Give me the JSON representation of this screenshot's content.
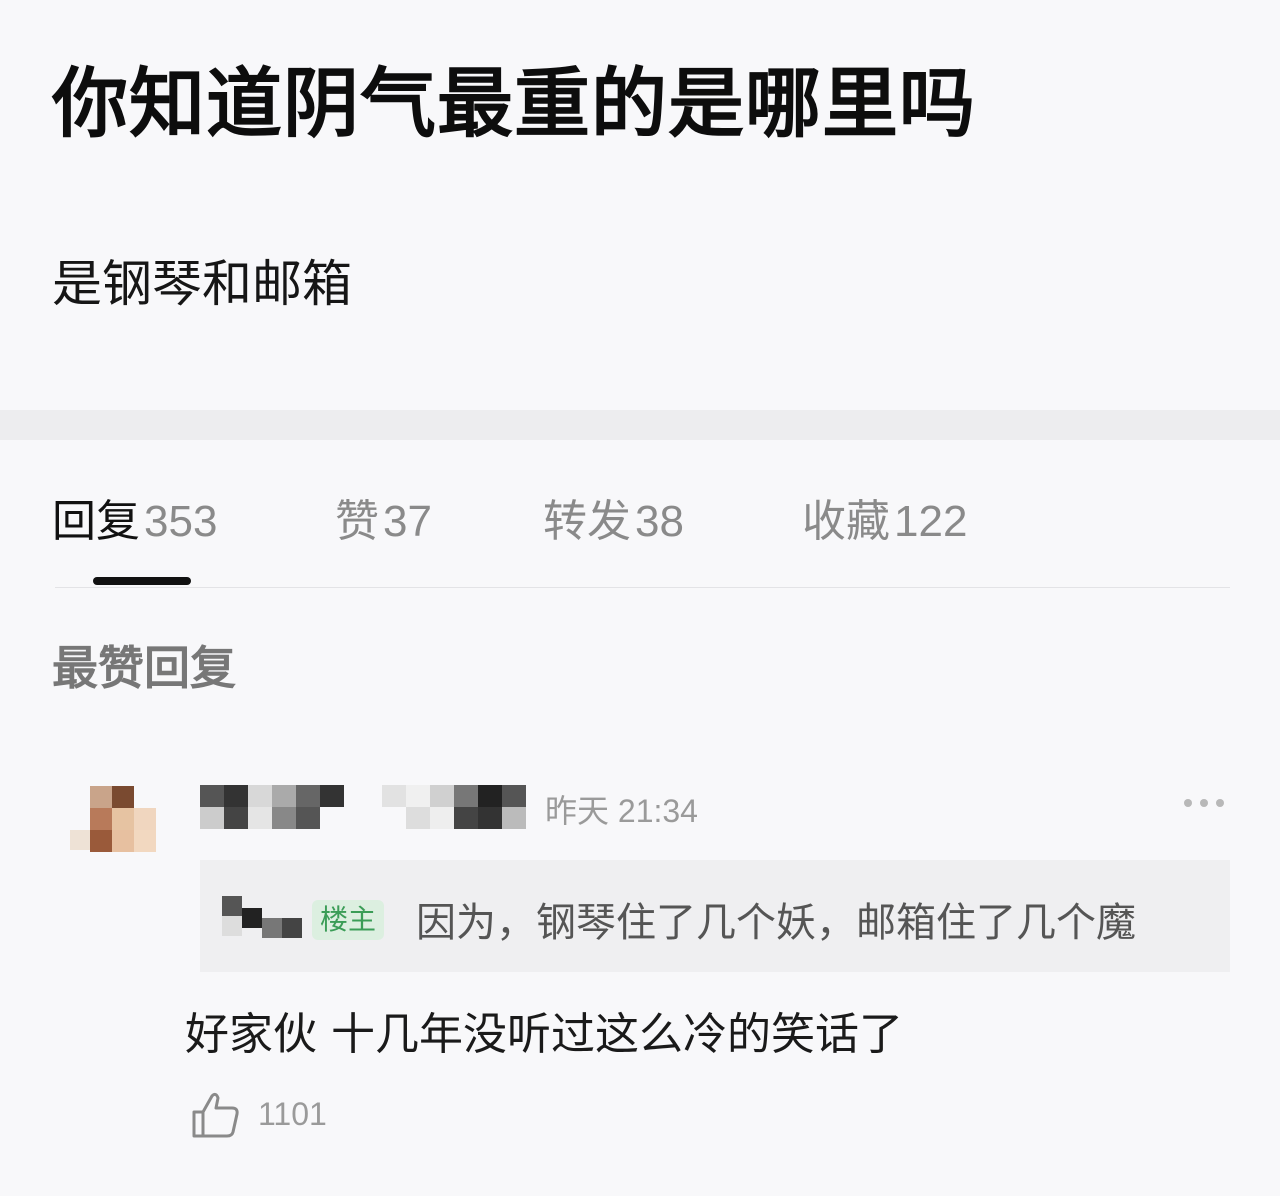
{
  "post": {
    "title": "你知道阴气最重的是哪里吗",
    "body": "是钢琴和邮箱"
  },
  "tabs": [
    {
      "label": "回复",
      "count": "353",
      "active": true
    },
    {
      "label": "赞",
      "count": "37",
      "active": false
    },
    {
      "label": "转发",
      "count": "38",
      "active": false
    },
    {
      "label": "收藏",
      "count": "122",
      "active": false
    }
  ],
  "section": {
    "heading": "最赞回复"
  },
  "comment": {
    "timestamp": "昨天 21:34",
    "quote": {
      "badge": "楼主",
      "text": "因为，钢琴住了几个妖，邮箱住了几个魔"
    },
    "text": "好家伙 十几年没听过这么冷的笑话了",
    "likes": "1101"
  },
  "colors": {
    "background": "#f8f8fa",
    "op_badge_bg": "#dcefe0",
    "op_badge_text": "#3b9d57"
  },
  "icons": [
    "more-icon",
    "thumbs-up-icon"
  ]
}
